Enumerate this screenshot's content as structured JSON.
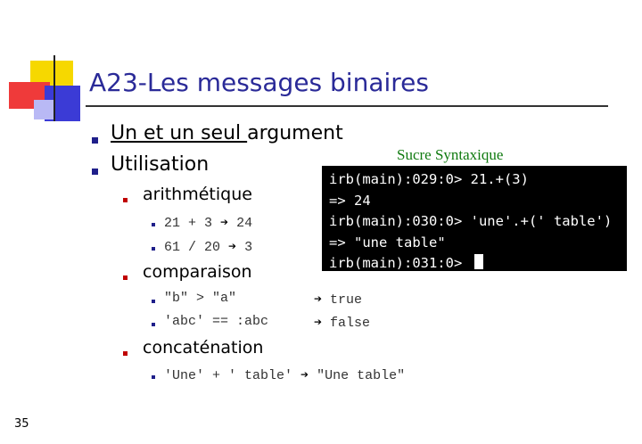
{
  "slide": {
    "title": "A23-Les messages binaires",
    "page_number": "35",
    "annotation": "Sucre Syntaxique"
  },
  "bullets": {
    "b1_underlined": "Un et un seul ",
    "b1_rest": "argument",
    "b2": "Utilisation",
    "arith": "arithmétique",
    "arith_1_expr": "21 + 3",
    "arith_1_result": "24",
    "arith_2_expr": "61 / 20",
    "arith_2_result": "3",
    "comp": "comparaison",
    "comp_1_expr": "\"b\" > \"a\"",
    "comp_1_result": "true",
    "comp_2_expr": "'abc' == :abc",
    "comp_2_result": "false",
    "concat": "concaténation",
    "concat_1_expr": "'Une' + ' table'",
    "concat_1_result": "\"Une table\"",
    "arrow": "➔"
  },
  "terminal": {
    "line1": "irb(main):029:0> 21.+(3)",
    "line2": "=> 24",
    "line3": "irb(main):030:0> 'une'.+(' table')",
    "line4": "=> \"une table\"",
    "line5": "irb(main):031:0> "
  },
  "colors": {
    "title": "#2a2a98",
    "annotation": "#0f7a0f",
    "terminal_bg": "#000000"
  }
}
